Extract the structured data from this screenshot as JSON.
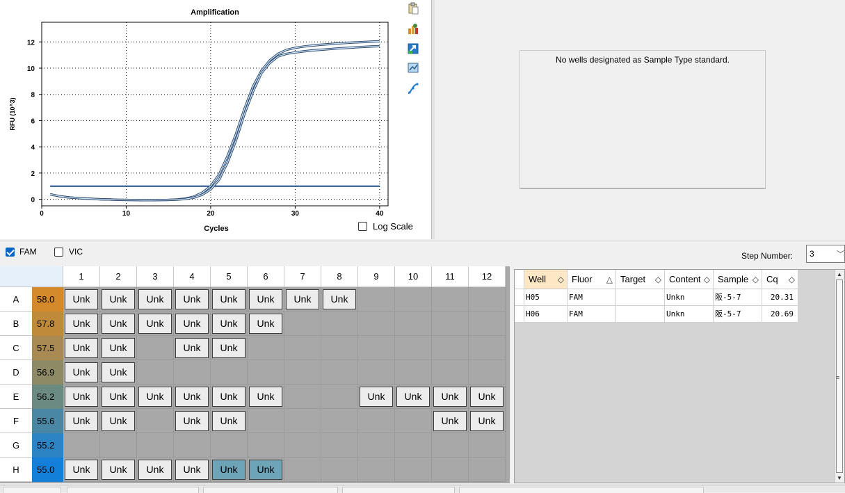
{
  "chart_data": {
    "type": "line",
    "title": "Amplification",
    "xlabel": "Cycles",
    "ylabel": "RFU (10^3)",
    "xlim": [
      0,
      41
    ],
    "ylim": [
      -0.5,
      13.5
    ],
    "xticks": [
      0,
      10,
      20,
      30,
      40
    ],
    "yticks": [
      0,
      2,
      4,
      6,
      8,
      10,
      12
    ],
    "grid": "dotted",
    "series": [
      {
        "name": "",
        "x": [
          1,
          2,
          3,
          4,
          5,
          6,
          7,
          8,
          9,
          10,
          11,
          12,
          13,
          14,
          15,
          16,
          17,
          18,
          19,
          20,
          21,
          22,
          23,
          24,
          25,
          26,
          27,
          28,
          29,
          30,
          31,
          32,
          33,
          34,
          35,
          36,
          37,
          38,
          39,
          40
        ],
        "values": [
          0.38,
          0.25,
          0.16,
          0.1,
          0.06,
          0.03,
          0.0,
          -0.02,
          -0.04,
          -0.05,
          -0.06,
          -0.07,
          -0.07,
          -0.06,
          -0.05,
          -0.02,
          0.05,
          0.2,
          0.5,
          1.0,
          1.9,
          3.3,
          5.0,
          6.9,
          8.6,
          9.8,
          10.6,
          11.1,
          11.4,
          11.55,
          11.65,
          11.72,
          11.78,
          11.83,
          11.88,
          11.92,
          11.96,
          11.99,
          12.02,
          12.05
        ]
      },
      {
        "name": "",
        "x": [
          1,
          2,
          3,
          4,
          5,
          6,
          7,
          8,
          9,
          10,
          11,
          12,
          13,
          14,
          15,
          16,
          17,
          18,
          19,
          20,
          21,
          22,
          23,
          24,
          25,
          26,
          27,
          28,
          29,
          30,
          31,
          32,
          33,
          34,
          35,
          36,
          37,
          38,
          39,
          40
        ],
        "values": [
          0.38,
          0.25,
          0.16,
          0.1,
          0.06,
          0.03,
          0.0,
          -0.02,
          -0.04,
          -0.05,
          -0.06,
          -0.07,
          -0.07,
          -0.06,
          -0.05,
          -0.03,
          0.02,
          0.12,
          0.35,
          0.75,
          1.5,
          2.8,
          4.5,
          6.5,
          8.2,
          9.6,
          10.4,
          10.9,
          11.1,
          11.2,
          11.28,
          11.35,
          11.4,
          11.45,
          11.5,
          11.54,
          11.58,
          11.62,
          11.65,
          11.68
        ]
      }
    ],
    "threshold": 1.0,
    "log_scale_label": "Log Scale",
    "log_scale_checked": false
  },
  "std_curve": {
    "message": "No wells designated as Sample Type standard."
  },
  "fluors": [
    {
      "label": "FAM",
      "checked": true
    },
    {
      "label": "VIC",
      "checked": false
    }
  ],
  "step": {
    "label": "Step Number:",
    "value": "3",
    "arrow": "﹀"
  },
  "plate": {
    "columns": [
      "1",
      "2",
      "3",
      "4",
      "5",
      "6",
      "7",
      "8",
      "9",
      "10",
      "11",
      "12"
    ],
    "rows": [
      {
        "label": "A",
        "temp": "58.0",
        "temp_color": "#d4892a",
        "wells": [
          "Unk",
          "Unk",
          "Unk",
          "Unk",
          "Unk",
          "Unk",
          "Unk",
          "Unk",
          "",
          "",
          "",
          ""
        ]
      },
      {
        "label": "B",
        "temp": "57.8",
        "temp_color": "#bf8a3a",
        "wells": [
          "Unk",
          "Unk",
          "Unk",
          "Unk",
          "Unk",
          "Unk",
          "",
          "",
          "",
          "",
          "",
          ""
        ]
      },
      {
        "label": "C",
        "temp": "57.5",
        "temp_color": "#a88a52",
        "wells": [
          "Unk",
          "Unk",
          "",
          "Unk",
          "Unk",
          "",
          "",
          "",
          "",
          "",
          "",
          ""
        ]
      },
      {
        "label": "D",
        "temp": "56.9",
        "temp_color": "#8f8a66",
        "wells": [
          "Unk",
          "Unk",
          "",
          "",
          "",
          "",
          "",
          "",
          "",
          "",
          "",
          ""
        ]
      },
      {
        "label": "E",
        "temp": "56.2",
        "temp_color": "#6a8a82",
        "wells": [
          "Unk",
          "Unk",
          "Unk",
          "Unk",
          "Unk",
          "Unk",
          "",
          "",
          "Unk",
          "Unk",
          "Unk",
          "Unk"
        ]
      },
      {
        "label": "F",
        "temp": "55.6",
        "temp_color": "#4a87a4",
        "wells": [
          "Unk",
          "Unk",
          "",
          "Unk",
          "Unk",
          "",
          "",
          "",
          "",
          "",
          "Unk",
          "Unk"
        ]
      },
      {
        "label": "G",
        "temp": "55.2",
        "temp_color": "#2c84c4",
        "wells": [
          "",
          "",
          "",
          "",
          "",
          "",
          "",
          "",
          "",
          "",
          "",
          ""
        ]
      },
      {
        "label": "H",
        "temp": "55.0",
        "temp_color": "#137fd8",
        "wells": [
          "Unk",
          "Unk",
          "Unk",
          "Unk",
          "Unk",
          "Unk",
          "",
          "",
          "",
          "",
          "",
          ""
        ]
      }
    ],
    "selected": [
      "H5",
      "H6"
    ]
  },
  "results": {
    "columns": [
      {
        "label": "Well",
        "sort": "◇"
      },
      {
        "label": "Fluor",
        "sort": "△"
      },
      {
        "label": "Target",
        "sort": "◇"
      },
      {
        "label": "Content",
        "sort": "◇"
      },
      {
        "label": "Sample",
        "sort": "◇"
      },
      {
        "label": "Cq",
        "sort": "◇"
      }
    ],
    "rows": [
      [
        "H05",
        "FAM",
        "",
        "Unkn",
        "阪-5-7",
        "20.31"
      ],
      [
        "H06",
        "FAM",
        "",
        "Unkn",
        "阪-5-7",
        "20.69"
      ]
    ]
  },
  "icons": [
    "clipboard-icon",
    "chart-settings-icon",
    "export-icon",
    "zoom-icon",
    "curve-icon"
  ]
}
